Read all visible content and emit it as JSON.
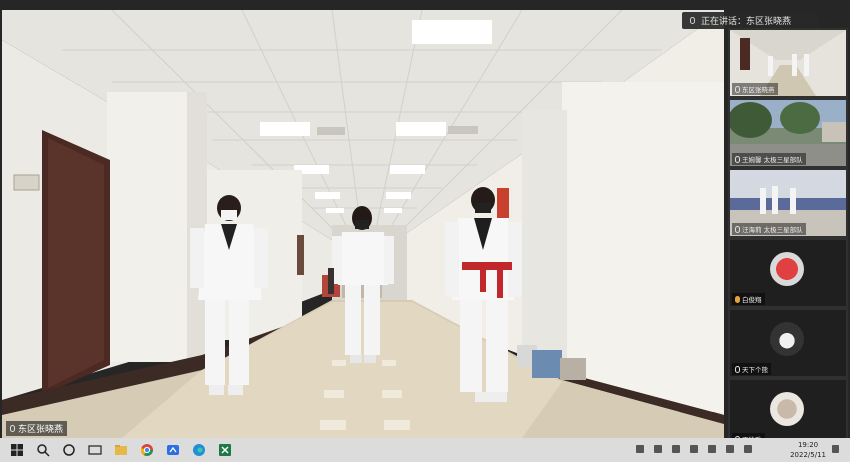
{
  "main_video": {
    "speaker_name": "东区张晓燕"
  },
  "speaking_toast": {
    "text": "正在讲话：东区张晓燕"
  },
  "participants": [
    {
      "name": "东区张晓燕"
    },
    {
      "name": "王婉馨 太极三星部队"
    },
    {
      "name": "汪海莉 太极三星部队"
    },
    {
      "name": "白俊翔"
    },
    {
      "name": "天下个熊"
    },
    {
      "name": "王徐雅"
    }
  ],
  "taskbar": {
    "time": "19:20",
    "date": "2022/5/11"
  },
  "colors": {
    "taskbar": "#dcdcdc",
    "gallery_bg": "#303030",
    "belt_red": "#c0282b"
  }
}
